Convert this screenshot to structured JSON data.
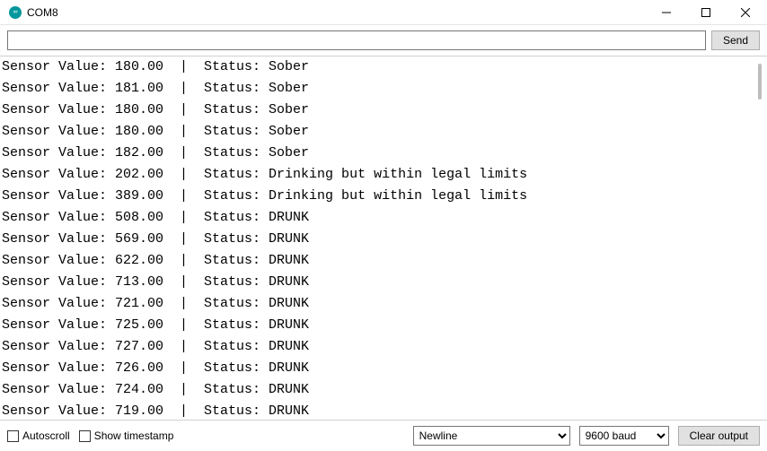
{
  "window": {
    "title": "COM8"
  },
  "topbar": {
    "input_value": "",
    "send_label": "Send"
  },
  "terminal": {
    "lines": [
      {
        "value": "180.00",
        "status": "Sober"
      },
      {
        "value": "181.00",
        "status": "Sober"
      },
      {
        "value": "180.00",
        "status": "Sober"
      },
      {
        "value": "180.00",
        "status": "Sober"
      },
      {
        "value": "182.00",
        "status": "Sober"
      },
      {
        "value": "202.00",
        "status": "Drinking but within legal limits"
      },
      {
        "value": "389.00",
        "status": "Drinking but within legal limits"
      },
      {
        "value": "508.00",
        "status": "DRUNK"
      },
      {
        "value": "569.00",
        "status": "DRUNK"
      },
      {
        "value": "622.00",
        "status": "DRUNK"
      },
      {
        "value": "713.00",
        "status": "DRUNK"
      },
      {
        "value": "721.00",
        "status": "DRUNK"
      },
      {
        "value": "725.00",
        "status": "DRUNK"
      },
      {
        "value": "727.00",
        "status": "DRUNK"
      },
      {
        "value": "726.00",
        "status": "DRUNK"
      },
      {
        "value": "724.00",
        "status": "DRUNK"
      },
      {
        "value": "719.00",
        "status": "DRUNK"
      }
    ],
    "line_prefix": "Sensor Value: ",
    "status_prefix": "Status: ",
    "separator": "  |  "
  },
  "bottombar": {
    "autoscroll_label": "Autoscroll",
    "timestamp_label": "Show timestamp",
    "line_ending_selected": "Newline",
    "baud_selected": "9600 baud",
    "clear_label": "Clear output"
  }
}
